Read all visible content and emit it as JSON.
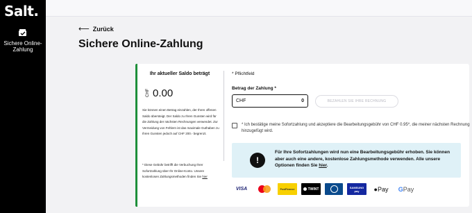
{
  "brand": {
    "logo": "Salt."
  },
  "sidebar": {
    "items": [
      {
        "label": "Sichere Online-Zahlung",
        "icon": "wallet-check-icon"
      }
    ]
  },
  "nav": {
    "back_label": "Zurück"
  },
  "page": {
    "title": "Sichere Online-Zahlung"
  },
  "saldo": {
    "title": "Ihr aktueller Saldo beträgt",
    "currency": "CHF",
    "amount": "0.00",
    "text": "Sie können einen Betrag einzahlen, der Ihren offenen Saldo übersteigt. Der Saldo zu Ihren Gunsten wird für die Zahlung der nächsten Rechnungen verwendet. Zur Vermeidung von Fehlern ist das maximale Guthaben zu Ihren Gunsten jedoch auf CHF 200.- begrenzt.",
    "note": "* Diese Gebühr betrifft die Verbuchung Ihrer Sofortzahlung über Ihr Online-Konto. Unsere kostenlosen Zahlungsmethoden finden Sie",
    "note_link": "hier"
  },
  "form": {
    "required_hint": "* Pflichtfeld",
    "amount_label": "Betrag der Zahlung *",
    "amount_currency": "CHF",
    "amount_value": "0",
    "pay_button": "BEZAHLEN SIE IHRE RECHNUNG",
    "confirm_text": "* Ich bestätige meine Sofortzahlung und akzeptiere die Bearbeitungsgebühr von CHF 0.95*, die meiner nächsten Rechnung hinzugefügt wird."
  },
  "info": {
    "icon": "exclamation-icon",
    "text": "Für Ihre Sofortzahlungen wird nun eine Bearbeitungsgebühr erhoben. Sie können aber auch eine andere, kostenlose Zahlungsmethode verwenden. Alle unsere Optionen finden Sie",
    "link": "hier",
    "suffix": "."
  },
  "payment_methods": {
    "visa": "VISA",
    "postfinance": "PostFinance",
    "twint": "TWINT",
    "samsung": "SAMSUNG",
    "samsung_sub": "pay",
    "apple": " Pay",
    "google_g": "G",
    "google": " Pay"
  },
  "colors": {
    "accent_green": "#1e8f3a",
    "info_bg": "#dff1f7",
    "sidebar_bg": "#000000"
  }
}
